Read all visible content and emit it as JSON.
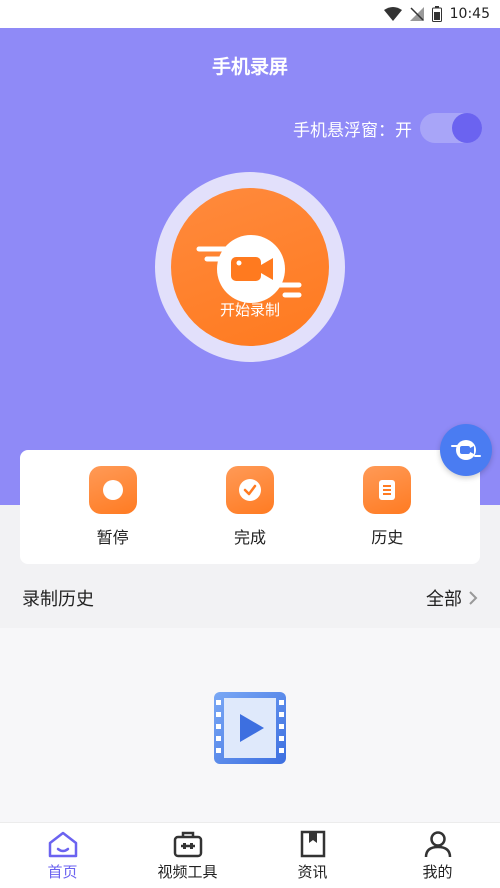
{
  "status_bar": {
    "time": "10:45"
  },
  "header": {
    "title": "手机录屏"
  },
  "floating_window": {
    "label": "手机悬浮窗：开",
    "enabled": true
  },
  "record_button": {
    "label": "开始录制"
  },
  "actions": [
    {
      "label": "暂停",
      "icon": "pause-icon"
    },
    {
      "label": "完成",
      "icon": "check-icon"
    },
    {
      "label": "历史",
      "icon": "history-icon"
    }
  ],
  "history": {
    "title": "录制历史",
    "view_all": "全部"
  },
  "bottom_nav": [
    {
      "label": "首页",
      "icon": "home-icon",
      "active": true
    },
    {
      "label": "视频工具",
      "icon": "toolbox-icon",
      "active": false
    },
    {
      "label": "资讯",
      "icon": "bookmark-icon",
      "active": false
    },
    {
      "label": "我的",
      "icon": "user-icon",
      "active": false
    }
  ],
  "colors": {
    "hero_bg": "#8f8af7",
    "accent": "#6b63f0",
    "orange": "#ff7a1f",
    "float_blue": "#4a7cf2"
  }
}
